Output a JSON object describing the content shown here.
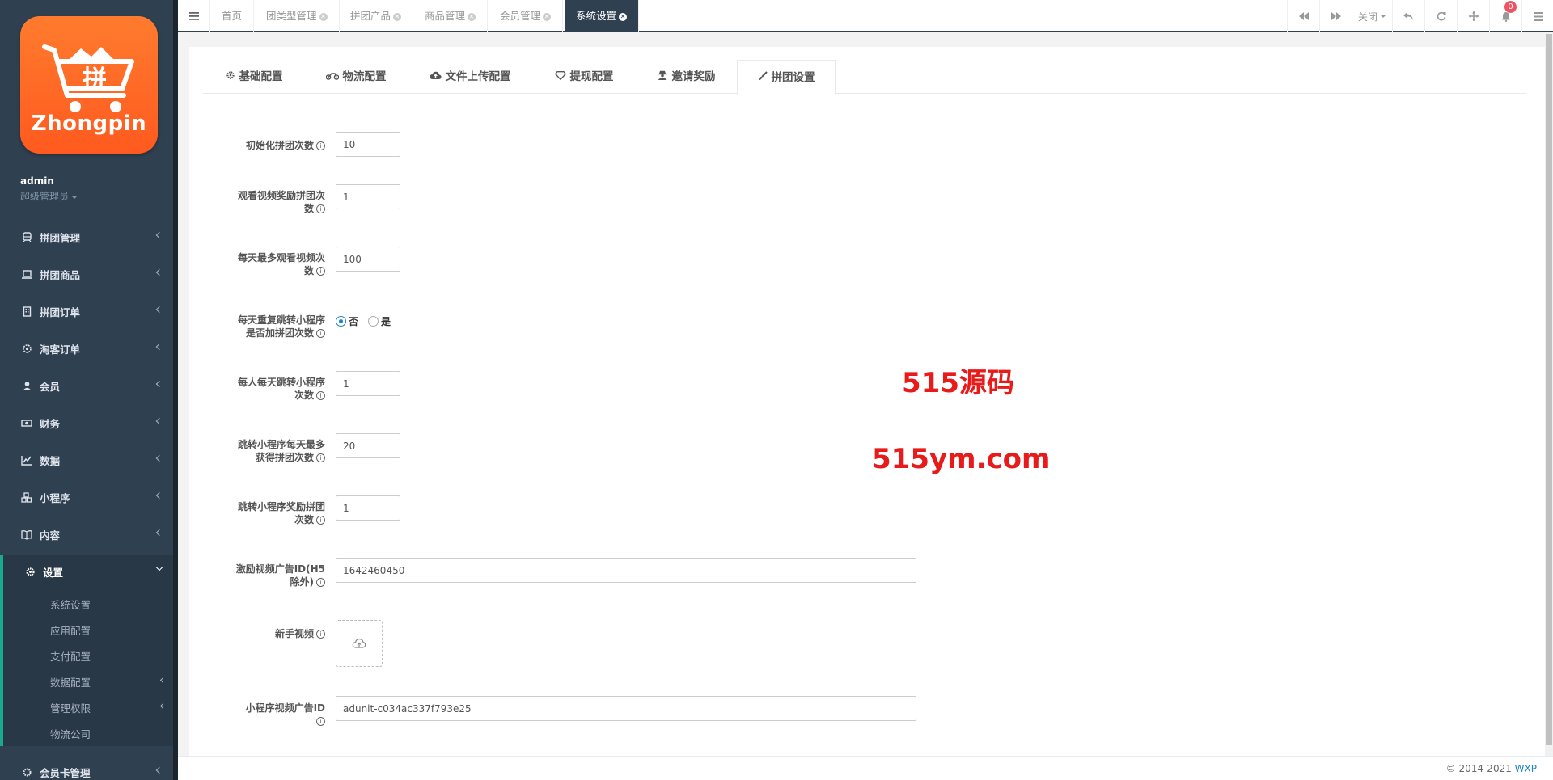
{
  "brand": {
    "logo_text": "Zhongpin"
  },
  "user": {
    "name": "admin",
    "role": "超级管理员"
  },
  "sidebar": {
    "items": [
      {
        "label": "拼团管理",
        "icon": "train-icon"
      },
      {
        "label": "拼团商品",
        "icon": "laptop-icon"
      },
      {
        "label": "拼团订单",
        "icon": "building-icon"
      },
      {
        "label": "淘客订单",
        "icon": "gears-icon"
      },
      {
        "label": "会员",
        "icon": "user-icon"
      },
      {
        "label": "财务",
        "icon": "money-icon"
      },
      {
        "label": "数据",
        "icon": "line-chart-icon"
      },
      {
        "label": "小程序",
        "icon": "cubes-icon"
      },
      {
        "label": "内容",
        "icon": "book-icon"
      },
      {
        "label": "设置",
        "icon": "gear-icon"
      },
      {
        "label": "会员卡管理",
        "icon": "gear-icon"
      }
    ],
    "sub_items": [
      {
        "label": "系统设置"
      },
      {
        "label": "应用配置"
      },
      {
        "label": "支付配置"
      },
      {
        "label": "数据配置"
      },
      {
        "label": "管理权限"
      },
      {
        "label": "物流公司"
      }
    ]
  },
  "topbar": {
    "tabs": [
      {
        "label": "首页"
      },
      {
        "label": "团类型管理"
      },
      {
        "label": "拼团产品"
      },
      {
        "label": "商品管理"
      },
      {
        "label": "会员管理"
      },
      {
        "label": "系统设置"
      }
    ],
    "close_label": "关闭",
    "notification_count": "0"
  },
  "config_tabs": [
    {
      "label": "基础配置",
      "icon": "gear-icon"
    },
    {
      "label": "物流配置",
      "icon": "motorcycle-icon"
    },
    {
      "label": "文件上传配置",
      "icon": "cloud-upload-icon"
    },
    {
      "label": "提现配置",
      "icon": "diamond-icon"
    },
    {
      "label": "邀请奖励",
      "icon": "user-secret-icon"
    },
    {
      "label": "拼团设置",
      "icon": "paint-brush-icon"
    }
  ],
  "form": {
    "f1": {
      "label": "初始化拼团次数",
      "value": "10"
    },
    "f2": {
      "label_line1": "观看视频奖励拼团次",
      "label_line2": "数",
      "value": "1"
    },
    "f3": {
      "label_line1": "每天最多观看视频次",
      "label_line2": "数",
      "value": "100"
    },
    "f4": {
      "label_line1": "每天重复跳转小程序",
      "label_line2": "是否加拼团次数",
      "option_no": "否",
      "option_yes": "是"
    },
    "f5": {
      "label_line1": "每人每天跳转小程序",
      "label_line2": "次数",
      "value": "1"
    },
    "f6": {
      "label_line1": "跳转小程序每天最多",
      "label_line2": "获得拼团次数",
      "value": "20"
    },
    "f7": {
      "label_line1": "跳转小程序奖励拼团",
      "label_line2": "次数",
      "value": "1"
    },
    "f8": {
      "label_line1": "激励视频广告ID(H5",
      "label_line2": "除外)",
      "value": "1642460450"
    },
    "f9": {
      "label": "新手视频"
    },
    "f10": {
      "label_line1": "小程序视频广告ID",
      "value": "adunit-c034ac337f793e25"
    }
  },
  "watermark": {
    "line1": "515源码",
    "line2": "515ym.com"
  },
  "footer": {
    "copyright": "© 2014-2021 ",
    "author": "WXP"
  },
  "colors": {
    "sidebar_bg": "#2f4050",
    "accent": "#19aa8d",
    "link": "#1c84c6",
    "watermark": "#e81a1a",
    "logo_orange": "#ff6a24"
  }
}
